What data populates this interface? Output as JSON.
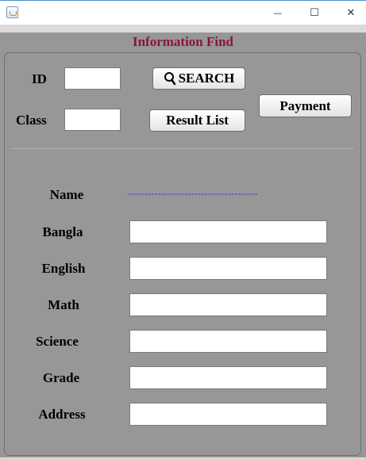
{
  "window": {
    "controls": {
      "minimize": "—",
      "maximize": "☐",
      "close": "✕"
    }
  },
  "header": {
    "title": "Information Find"
  },
  "search": {
    "id_label": "ID",
    "id_value": "",
    "class_label": "Class",
    "class_value": "",
    "search_button": "SEARCH",
    "result_list_button": "Result List",
    "payment_button": "Payment"
  },
  "result": {
    "name_label": "Name",
    "name_value": "---------------------------------------",
    "fields": [
      {
        "label": "Bangla",
        "value": ""
      },
      {
        "label": "English",
        "value": ""
      },
      {
        "label": "Math",
        "value": ""
      },
      {
        "label": "Science",
        "value": ""
      },
      {
        "label": "Grade",
        "value": ""
      },
      {
        "label": "Address",
        "value": ""
      }
    ]
  },
  "colors": {
    "title_color": "#8b1538",
    "frame_background": "#979797",
    "name_dash_color": "#2a3cd8"
  },
  "icons": {
    "app": "java-cup-icon",
    "search": "magnifier-icon"
  }
}
